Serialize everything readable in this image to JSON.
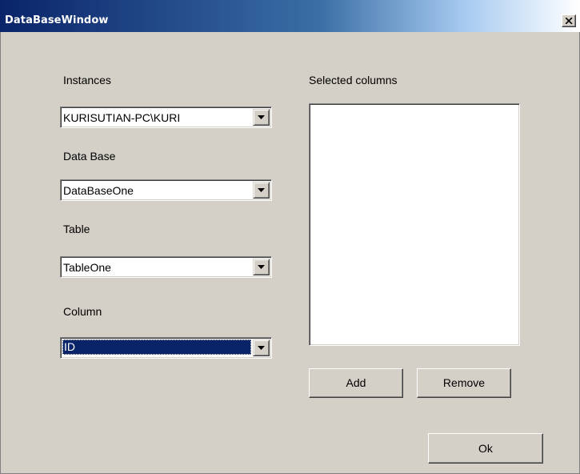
{
  "window": {
    "title": "DataBaseWindow",
    "close_icon": "close-x-icon"
  },
  "form": {
    "instances": {
      "label": "Instances",
      "value": "KURISUTIAN-PC\\KURI"
    },
    "database": {
      "label": "Data Base",
      "value": "DataBaseOne"
    },
    "table": {
      "label": "Table",
      "value": "TableOne"
    },
    "column": {
      "label": "Column",
      "value": "ID"
    }
  },
  "selected_columns": {
    "label": "Selected columns",
    "items": []
  },
  "buttons": {
    "add": "Add",
    "remove": "Remove",
    "ok": "Ok"
  },
  "colors": {
    "titlebar_start": "#0a246a",
    "titlebar_end": "#a6caf0",
    "window_bg": "#d4d0c8",
    "selection": "#0a246a"
  }
}
